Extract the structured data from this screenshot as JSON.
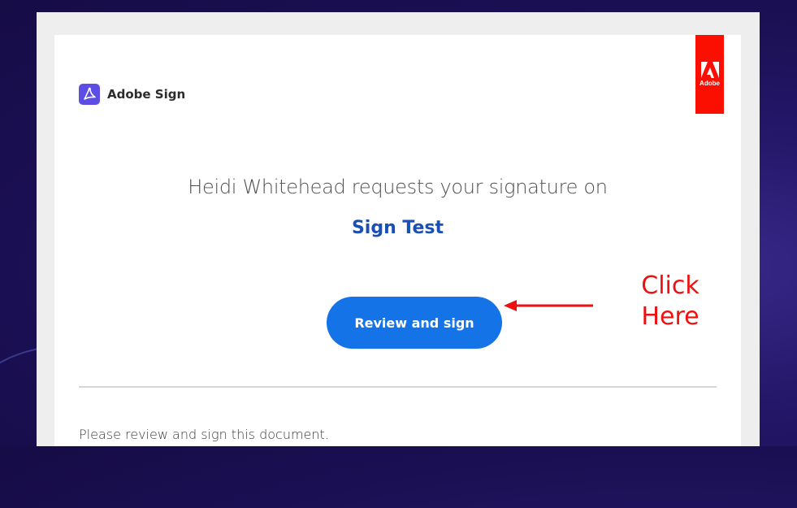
{
  "brand": {
    "product_name": "Adobe Sign",
    "badge_text": "Adobe",
    "icon": "acrobat-icon",
    "badge_icon": "adobe-logo-icon"
  },
  "email": {
    "request_text": "Heidi Whitehead requests your signature on",
    "document_name": "Sign Test",
    "button_label": "Review and sign",
    "footer_message": "Please review and sign this document."
  },
  "annotation": {
    "line1": "Click",
    "line2": "Here",
    "arrow_icon": "left-arrow-icon"
  },
  "colors": {
    "button": "#1473e6",
    "document_title": "#1a4fb5",
    "adobe_red": "#fa0f00",
    "brand_icon_bg": "#5c4ee5",
    "annotation": "#ee1111",
    "background": "#1a0f52"
  }
}
